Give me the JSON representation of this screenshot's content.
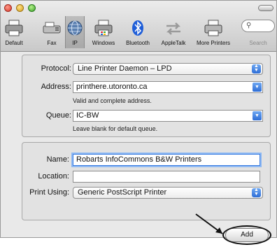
{
  "toolbar": {
    "items": [
      {
        "label": "Default",
        "icon": "printer-icon"
      },
      {
        "label": "Fax",
        "icon": "fax-icon"
      },
      {
        "label": "IP",
        "icon": "globe-icon",
        "selected": true
      },
      {
        "label": "Windows",
        "icon": "windows-printer-icon"
      },
      {
        "label": "Bluetooth",
        "icon": "bluetooth-icon"
      },
      {
        "label": "AppleTalk",
        "icon": "appletalk-icon"
      },
      {
        "label": "More Printers",
        "icon": "printer-icon"
      }
    ],
    "search_label": "Search"
  },
  "connection": {
    "protocol_label": "Protocol:",
    "protocol_value": "Line Printer Daemon – LPD",
    "address_label": "Address:",
    "address_value": "printhere.utoronto.ca",
    "address_hint": "Valid and complete address.",
    "queue_label": "Queue:",
    "queue_value": "IC-BW",
    "queue_hint": "Leave blank for default queue."
  },
  "details": {
    "name_label": "Name:",
    "name_value": "Robarts InfoCommons B&W Printers",
    "location_label": "Location:",
    "location_value": "",
    "print_using_label": "Print Using:",
    "print_using_value": "Generic PostScript Printer"
  },
  "actions": {
    "add_label": "Add"
  },
  "colors": {
    "accent": "#2d6dd6",
    "focus_ring": "#8fb9f3",
    "bluetooth": "#1f5ed8"
  }
}
